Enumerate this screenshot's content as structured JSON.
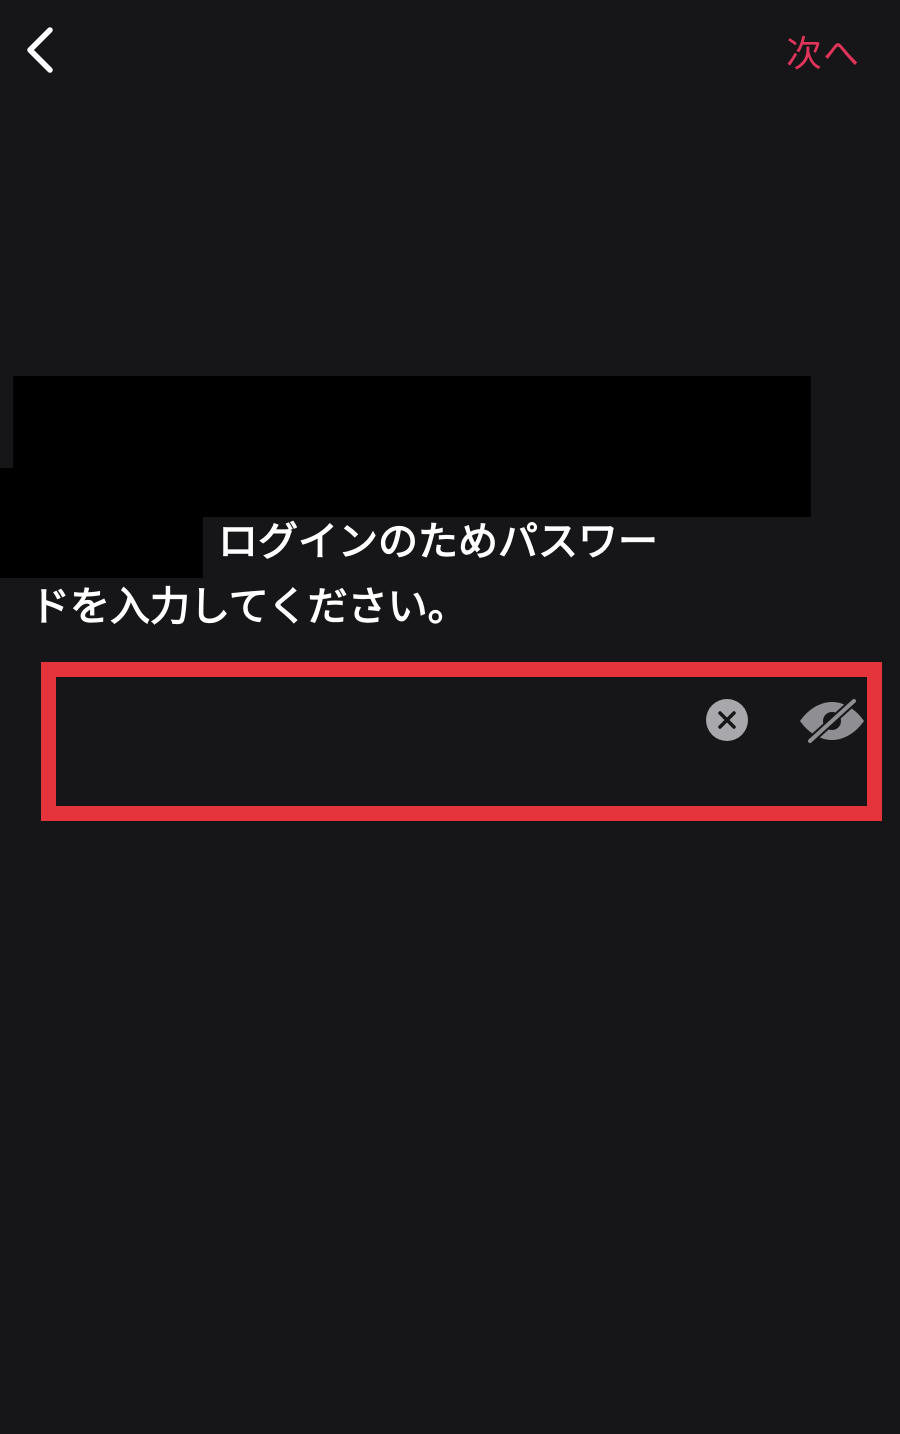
{
  "header": {
    "back_icon": "chevron-left-icon",
    "next_label": "次へ",
    "accent_color": "#e0345a"
  },
  "prompt": {
    "line1": "ログインのためパスワー",
    "line2": "ドを入力してください。"
  },
  "password_field": {
    "value": "",
    "placeholder": "",
    "clear_icon": "clear-circle-icon",
    "visibility_icon": "eye-slash-icon",
    "highlight_color": "#e5343c"
  }
}
